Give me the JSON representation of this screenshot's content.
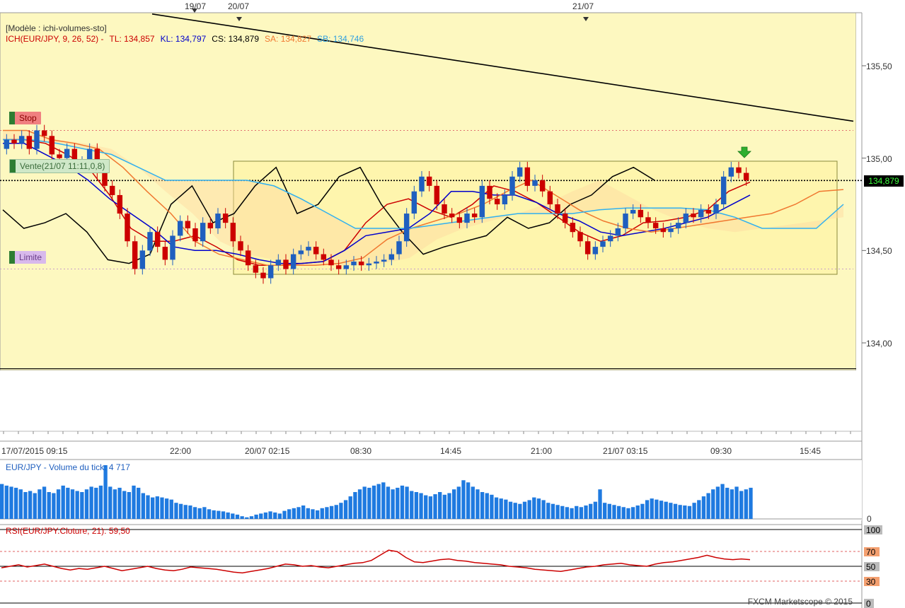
{
  "template_line": "[Modèle : ichi-volumes-sto]",
  "legend": {
    "ich": "ICH(EUR/JPY, 9, 26, 52) -",
    "tl": "TL: 134,857",
    "kl": "KL: 134,797",
    "cs": "CS: 134,879",
    "sa": "SA: 134,827",
    "sb": "SB: 134,746"
  },
  "colors": {
    "tl": "#cc0000",
    "kl": "#0000cc",
    "cs": "#000000",
    "sa": "#f07830",
    "sb": "#30b0f0",
    "volume": "#1f7ae0",
    "rsi": "#cc0000",
    "plot_bg": "#fdf8c0",
    "candle_up": "#1f5fbf",
    "candle_down": "#cc0000"
  },
  "orders": {
    "stop": "Stop",
    "vente": "Vente(21/07 11:11,0,8)",
    "limite": "Limite"
  },
  "current_price": "134,879",
  "date_markers": [
    "19/07",
    "20/07",
    "21/07"
  ],
  "volume_legend": "EUR/JPY - Volume du tick: 4 717",
  "rsi_legend": "RSI(EUR/JPY.Cloture, 21): 59,50",
  "watermark": "FXCM Marketscope © 2015",
  "chart_data": [
    {
      "type": "candlestick",
      "title": "",
      "yticks": [
        "135,50",
        "135,00",
        "134,50",
        "134,00"
      ],
      "ylim": [
        133.5,
        135.8
      ],
      "xticks": [
        "17/07/2015 09:15",
        "22:00",
        "20/07 02:15",
        "08:30",
        "14:45",
        "21:00",
        "21/07 03:15",
        "09:30",
        "15:45"
      ],
      "levels": {
        "stop": 135.15,
        "limite": 134.4,
        "current": 134.879,
        "support": 133.86
      },
      "trendline": {
        "from": 135.78,
        "to": 135.2
      },
      "close": [
        135.1,
        135.08,
        135.12,
        135.05,
        135.15,
        135.12,
        135.02,
        135.0,
        135.05,
        134.95,
        134.98,
        135.05,
        134.92,
        134.85,
        134.8,
        134.7,
        134.55,
        134.4,
        134.5,
        134.6,
        134.52,
        134.45,
        134.58,
        134.66,
        134.62,
        134.55,
        134.65,
        134.62,
        134.7,
        134.65,
        134.55,
        134.5,
        134.42,
        134.38,
        134.35,
        134.42,
        134.45,
        134.4,
        134.48,
        134.5,
        134.52,
        134.48,
        134.45,
        134.42,
        134.4,
        134.42,
        134.44,
        134.42,
        134.43,
        134.44,
        134.45,
        134.48,
        134.55,
        134.7,
        134.82,
        134.9,
        134.85,
        134.75,
        134.7,
        134.68,
        134.65,
        134.7,
        134.68,
        134.85,
        134.78,
        134.75,
        134.8,
        134.9,
        134.95,
        134.85,
        134.88,
        134.82,
        134.75,
        134.7,
        134.65,
        134.6,
        134.55,
        134.48,
        134.52,
        134.55,
        134.58,
        134.62,
        134.7,
        134.72,
        134.68,
        134.65,
        134.62,
        134.6,
        134.62,
        134.65,
        134.7,
        134.68,
        134.72,
        134.7,
        134.75,
        134.9,
        134.95,
        134.92,
        134.88
      ],
      "open": [
        135.05,
        135.1,
        135.08,
        135.12,
        135.05,
        135.15,
        135.12,
        135.02,
        135.0,
        135.05,
        134.95,
        134.98,
        135.05,
        134.92,
        134.85,
        134.8,
        134.7,
        134.55,
        134.4,
        134.5,
        134.6,
        134.52,
        134.45,
        134.58,
        134.66,
        134.62,
        134.55,
        134.65,
        134.62,
        134.7,
        134.65,
        134.55,
        134.5,
        134.42,
        134.38,
        134.35,
        134.42,
        134.45,
        134.4,
        134.48,
        134.5,
        134.52,
        134.48,
        134.45,
        134.42,
        134.4,
        134.42,
        134.44,
        134.42,
        134.43,
        134.44,
        134.45,
        134.48,
        134.55,
        134.7,
        134.82,
        134.9,
        134.85,
        134.75,
        134.7,
        134.68,
        134.65,
        134.7,
        134.68,
        134.85,
        134.78,
        134.75,
        134.8,
        134.9,
        134.95,
        134.85,
        134.88,
        134.82,
        134.75,
        134.7,
        134.65,
        134.6,
        134.55,
        134.48,
        134.52,
        134.55,
        134.58,
        134.62,
        134.7,
        134.72,
        134.68,
        134.65,
        134.62,
        134.6,
        134.62,
        134.65,
        134.7,
        134.68,
        134.72,
        134.7,
        134.75,
        134.9,
        134.95,
        134.92
      ],
      "series": [
        {
          "name": "TL",
          "values": [
            135.1,
            135.1,
            135.08,
            135.02,
            134.95,
            134.8,
            134.62,
            134.55,
            134.55,
            134.58,
            134.52,
            134.45,
            134.42,
            134.42,
            134.43,
            134.44,
            134.5,
            134.65,
            134.75,
            134.78,
            134.72,
            134.68,
            134.75,
            134.85,
            134.82,
            134.76,
            134.68,
            134.6,
            134.55,
            134.58,
            134.65,
            134.66,
            134.68,
            134.72,
            134.82,
            134.87
          ]
        },
        {
          "name": "KL",
          "values": [
            135.08,
            135.08,
            135.02,
            134.96,
            134.88,
            134.78,
            134.7,
            134.62,
            134.52,
            134.5,
            134.5,
            134.48,
            134.45,
            134.43,
            134.43,
            134.44,
            134.5,
            134.58,
            134.6,
            134.62,
            134.7,
            134.82,
            134.82,
            134.8,
            134.8,
            134.76,
            134.7,
            134.66,
            134.6,
            134.58,
            134.6,
            134.62,
            134.65,
            134.68,
            134.74,
            134.8
          ]
        },
        {
          "name": "CS",
          "values": [
            134.72,
            134.62,
            134.65,
            134.7,
            134.6,
            134.45,
            134.43,
            134.48,
            134.75,
            134.85,
            134.65,
            134.7,
            134.85,
            134.95,
            134.7,
            134.75,
            134.9,
            134.95,
            134.75,
            134.6,
            134.48,
            134.52,
            134.55,
            134.58,
            134.68,
            134.62,
            134.65,
            134.75,
            134.8,
            134.9,
            134.95,
            134.88
          ]
        },
        {
          "name": "SA",
          "values": [
            135.15,
            135.15,
            135.1,
            135.08,
            135.05,
            134.95,
            134.82,
            134.7,
            134.55,
            134.48,
            134.45,
            134.42,
            134.42,
            134.42,
            134.43,
            134.46,
            134.56,
            134.62,
            134.66,
            134.7,
            134.75,
            134.82,
            134.88,
            134.8,
            134.72,
            134.66,
            134.62,
            134.6,
            134.62,
            134.64,
            134.66,
            134.68,
            134.7,
            134.75,
            134.82,
            134.83
          ]
        },
        {
          "name": "SB",
          "values": [
            135.1,
            135.1,
            135.08,
            135.05,
            135.02,
            134.95,
            134.88,
            134.88,
            134.88,
            134.88,
            134.85,
            134.78,
            134.7,
            134.62,
            134.62,
            134.62,
            134.64,
            134.66,
            134.68,
            134.7,
            134.7,
            134.7,
            134.72,
            134.73,
            134.73,
            134.73,
            134.72,
            134.68,
            134.62,
            134.62,
            134.62,
            134.75
          ]
        }
      ]
    },
    {
      "type": "bar",
      "title": "",
      "yticks": [
        "0"
      ],
      "values": [
        65,
        62,
        60,
        58,
        55,
        50,
        52,
        48,
        55,
        60,
        50,
        48,
        55,
        62,
        58,
        55,
        52,
        50,
        55,
        60,
        58,
        62,
        100,
        60,
        55,
        58,
        52,
        50,
        62,
        58,
        48,
        44,
        40,
        42,
        40,
        38,
        36,
        30,
        28,
        26,
        25,
        22,
        20,
        22,
        18,
        16,
        15,
        14,
        12,
        10,
        8,
        5,
        3,
        5,
        8,
        10,
        12,
        14,
        12,
        10,
        15,
        18,
        20,
        22,
        25,
        20,
        18,
        16,
        20,
        22,
        24,
        26,
        30,
        35,
        42,
        50,
        55,
        60,
        58,
        62,
        65,
        68,
        60,
        55,
        58,
        62,
        60,
        52,
        50,
        48,
        44,
        42,
        46,
        50,
        45,
        48,
        55,
        60,
        72,
        68,
        60,
        55,
        50,
        48,
        45,
        40,
        38,
        36,
        32,
        30,
        28,
        32,
        35,
        40,
        38,
        35,
        30,
        28,
        26,
        24,
        22,
        20,
        24,
        22,
        25,
        28,
        32,
        55,
        30,
        28,
        26,
        24,
        22,
        20,
        22,
        25,
        28,
        35,
        38,
        36,
        34,
        32,
        30,
        28,
        26,
        25,
        24,
        30,
        35,
        42,
        48,
        55,
        60,
        65,
        58,
        55,
        60,
        52,
        55,
        58
      ],
      "color": "#1f7ae0"
    },
    {
      "type": "line",
      "title": "",
      "yticks": [
        "100",
        "70",
        "50",
        "30",
        "0"
      ],
      "ylim": [
        0,
        100
      ],
      "series": [
        {
          "name": "RSI",
          "values": [
            48,
            50,
            52,
            49,
            51,
            53,
            50,
            47,
            45,
            47,
            46,
            48,
            50,
            47,
            44,
            46,
            48,
            50,
            47,
            45,
            44,
            46,
            49,
            48,
            47,
            46,
            44,
            42,
            41,
            43,
            45,
            47,
            50,
            53,
            52,
            50,
            51,
            49,
            48,
            50,
            52,
            54,
            55,
            58,
            65,
            72,
            70,
            62,
            56,
            55,
            57,
            59,
            60,
            58,
            57,
            55,
            54,
            53,
            52,
            50,
            49,
            48,
            46,
            45,
            44,
            43,
            45,
            47,
            49,
            50,
            52,
            53,
            54,
            52,
            51,
            50,
            53,
            55,
            56,
            58,
            60,
            62,
            65,
            62,
            60,
            59,
            60,
            59
          ]
        }
      ],
      "color": "#cc0000"
    }
  ]
}
